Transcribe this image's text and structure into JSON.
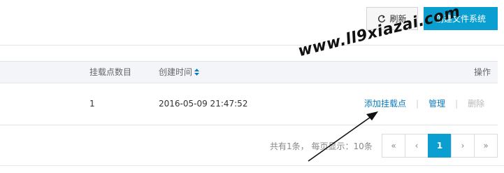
{
  "toolbar": {
    "refresh_label": "刷新",
    "refresh_icon": "refresh-icon",
    "create_label": "创建文件系统",
    "create_color": "#0a9ed1"
  },
  "table": {
    "columns": {
      "mount_count": "挂载点数目",
      "created_time": "创建时间",
      "actions": "操作"
    },
    "sort_icon": "sort-icon",
    "rows": [
      {
        "mount_count": "1",
        "created_time": "2016-05-09 21:47:52",
        "actions": {
          "add_mount": "添加挂载点",
          "manage": "管理",
          "delete": "删除"
        }
      }
    ]
  },
  "pagination": {
    "info": "共有1条， 每页显示：10条",
    "first": "«",
    "prev": "‹",
    "current": "1",
    "next": "›",
    "last": "»"
  },
  "watermark": "www.ll9xiazai.com"
}
